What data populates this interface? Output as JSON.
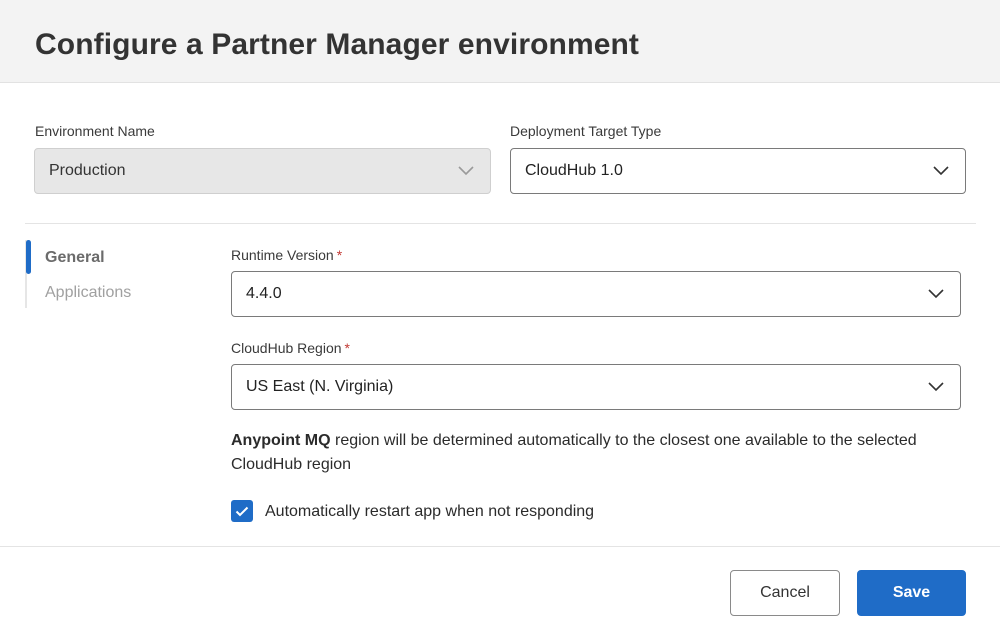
{
  "dialog": {
    "title": "Configure a Partner Manager environment"
  },
  "environment": {
    "label": "Environment Name",
    "value": "Production"
  },
  "deployment": {
    "label": "Deployment Target Type",
    "value": "CloudHub 1.0"
  },
  "nav": {
    "items": [
      {
        "label": "General",
        "active": true
      },
      {
        "label": "Applications",
        "active": false
      }
    ]
  },
  "runtime": {
    "label": "Runtime Version",
    "required_mark": "*",
    "value": "4.4.0"
  },
  "region": {
    "label": "CloudHub Region",
    "required_mark": "*",
    "value": "US East (N. Virginia)"
  },
  "info": {
    "bold": "Anypoint MQ",
    "text": " region will be determined automatically to the closest one available to the selected CloudHub region"
  },
  "auto_restart": {
    "label": "Automatically restart app when not responding",
    "checked": true
  },
  "footer": {
    "cancel_label": "Cancel",
    "save_label": "Save"
  },
  "colors": {
    "accent": "#1f6cc7",
    "required": "#c23934"
  }
}
